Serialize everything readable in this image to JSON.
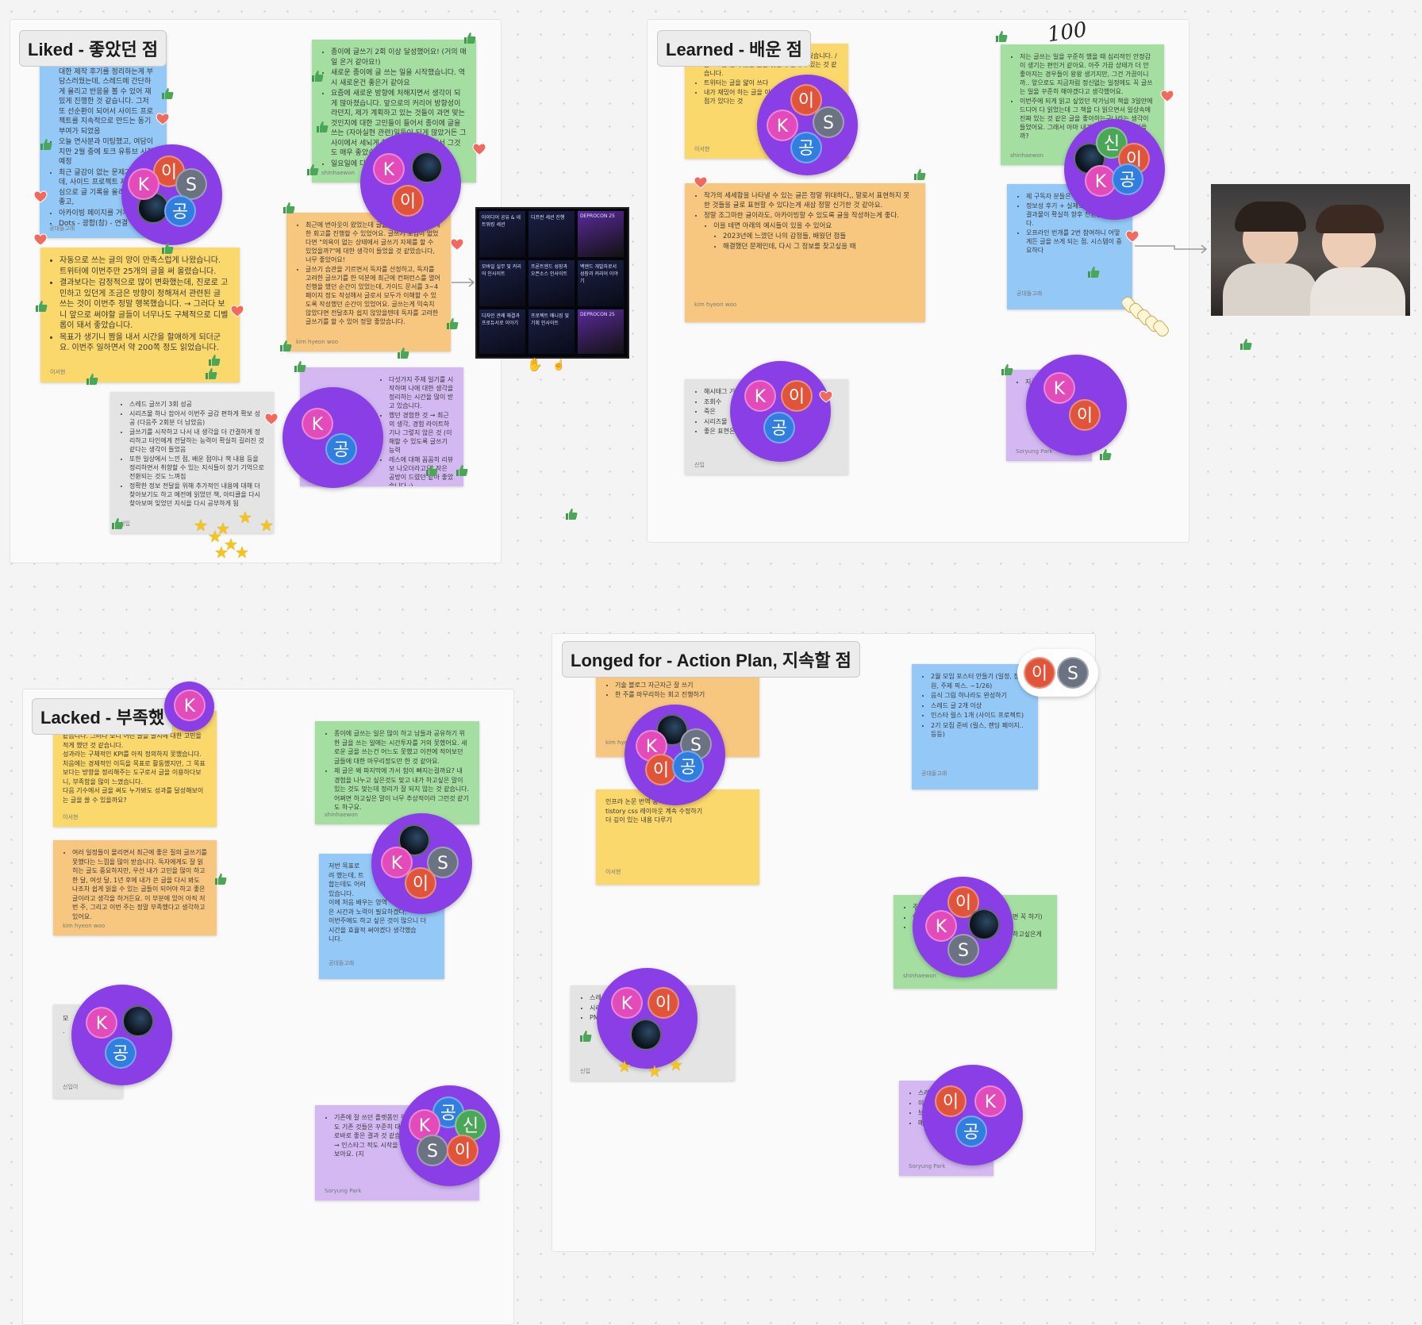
{
  "sections": {
    "liked": "Liked - 좋았던 점",
    "learned": "Learned - 배운 점",
    "lacked": "Lacked - 부족했",
    "longed": "Longed for -  Action Plan, 지속할 점"
  },
  "handwriting": "100",
  "avatars": {
    "k": "K",
    "i": "이",
    "s": "S",
    "g": "공",
    "sin": "신"
  },
  "colors": {
    "cluster": "#8a3ee6",
    "thumb": "#4aa757",
    "heart": "#f06a5e",
    "star": "#f5c518"
  },
  "stickies": {
    "liked_blue": {
      "items": [
        "사이드 프로젝트를 만들고 이에 대한 제작 후기를 정리하는게 부담스러웠는데, 스레드에 간단하게 올리고 반응을 볼 수 있어 재밌게 진행한 것 같습니다. 그저 또 선순환이 되어서 사이드 프로젝트를 지속적으로 만드는 동기부여가 되었음",
        "오늘 연사분과 미팅했고, 여담이지만 2월 중에 토크 유튜브 시작 예정",
        "최근 글감이 없는 문제가 있었는데, 사이드 프로젝트 제작기를 중심으로 글 기록을 올리니 반응도 좋고,",
        "아카이빙 페이지를 거쳐",
        "Dots - 광합(참) - 연결"
      ],
      "author": "공대돌고래"
    },
    "liked_green": {
      "items": [
        "종이에 글쓰기 2회 이상 달성했어요! (거의 매일 온거 같아요!)",
        "새로운 종이에 글 쓰는 일을 시작했습니다. 역시 새로운건 좋은거 같아요",
        "요즘에 새로운 방향에 처해지면서 생각이 되게 많아졌습니다. 앞으로의 커리어 방향성이라던지, 제가 계획하고 있는 것들이 과연 맞는것인지에 대한 고민들이 들어서 종이에 글을 쓰는 (자아실현 관련)일들이 되게 많았거든 그 사이에서 세뇌게 찾은 주제들이 있어서 그것도 매우 좋았습니다.",
        "일요일에 다음주"
      ],
      "author": "shinhaewon"
    },
    "liked_yellow": {
      "items": [
        "자동으로 쓰는 글의 양이 만족스럽게 나왔습니다. 트위터에 이번주만 25개의 글을 써 올렸습니다.",
        "결과보다는 감정적으로 많이 변화했는데, 진로로 고민하고 있던게 조금은 방향이 정해져서 관련된 글 쓰는 것이 이번주 정말 행복했습니다. → 그러다 보니 앞으로 써야할 글들이 너무나도 구체적으로 디벨롭이 돼서 좋았습니다.",
        "목표가 생기니 짬을 내서 시간을 할애하게 되더군요. 이번주 일하면서 약 200쪽 정도 읽었습니다."
      ],
      "author": "이서현"
    },
    "liked_orange": {
      "items": [
        "최근에 번아웃이 왔었는데 글을 쓰면서 번아웃에 대한 회고를 진행할 수 있었어요. 글쓰기 모임이 없었다면 \"의욕이 없는 상태에서 글쓰기 자체를 할 수 있었을까?\"에 대한 생각이 들었을 것 같았습니다, 너무 좋았어요!",
        "글쓰기 습관을 기르면서 독자를 선정하고, 독자를 고려한 글쓰기를 한 덕분에 최근에 컨퍼런스를 열어 진행을 했던 순간이 있었는데, 가이드 문서를 3~4 페이지 정도 작성해서 글로서 모두가 이해할 수 있도록 작성했던 순간이 있었어요. 글쓰는게 익숙치 않았다면 전달조차 쉽지 않았을텐데 독자를 고려한 글쓰기를 할 수 있어 정말 좋았습니다."
      ],
      "author": "kim hyeon woo"
    },
    "liked_gray": {
      "items": [
        "스레드 글쓰기 3회 성공",
        "시리즈물 하나 잡아서 이번주 글감 편하게 확보 성공 (다음주 2회분 더 남았음)",
        "글쓰기를 시작하고 나서 내 생각을 더 간결하게 정리하고 타인에게 전달하는 능력이 확실히 길러진 것 같다는 생각이 들었음",
        "또한 일상에서 느낀 점, 배운 점이나 책 내용 등을 정리하면서 취향할 수 있는 지식들이 장기 기억으로 전환되는 것도 느껴짐",
        "정확한 정보 전달을 위해 추가적인 내용에 대해 더 찾아보기도 하고 예전에 읽었던 책, 아티클을 다시 찾아보며 잊었던 지식을 다시 공부하게 됨"
      ],
      "author": "신입"
    },
    "liked_purple": {
      "items": [
        "다섯가지 주제 일기를 시작하며 나에 대한 생각을 정리하는 시간을 많이 받고 있습니다.",
        "했던 경험한 것 → 최근의 생각, 경험 라이트하기나 그렇지 않은 것 (이해할 수 있도록 글쓰기 능력",
        "레스에 대해 꼼꼼히 리뷰 보 나오더라고요. 작은 공방이 드렸던 같아 좋았습니다 :)"
      ],
      "author": ""
    },
    "learned_yellow": {
      "items": [
        "을 너무 간헌하게 확장시켜주는 것을 배웠습니다. / 볼로그는 깊이 있는 글을 찾는데 한계가 있는 것 같습니다.",
        "트위터는 글을 얇이 쓰다",
        "내가 재밌어 하는 글을 이게가 아니라 만드는 시작점가 있다는 것"
      ],
      "author": "이서현"
    },
    "learned_orange": {
      "items": [
        "작가의 세세함을 나타낼 수 있는 글은 정말 위대하다,, 말로서 표현하지 못한 것들을 글로 표현할 수 있다는게 새삼 정말 신기한 것 같아요.",
        "정말 조그마한 글이라도, 아카이빙할 수 있도록 글을 작성하는게 좋다.",
        "이을 테면 아래의 예시들이 있을 수 있어요",
        "2023년에 느꼈던 나의 감정들, 배웠던 점들",
        "해결했던 문제인데, 다시 그 정보를 찾고싶을 때"
      ],
      "author": "kim hyeon woo"
    },
    "learned_gray": {
      "items": [
        "해시태그 기",
        "조회수",
        "죽은",
        "시리즈물",
        "좋은 표현은"
      ],
      "author": "신입"
    },
    "learned_green": {
      "items": [
        "저는 글쓰는 일을 꾸준히 했을 때 심리적인 안정감이 생기는 편인거 같아요. 아주 가끔 상태가 더 안좋아지는 경우들이 왕왕 생기지만, 그건 가끔이니까.. 앞으로도 지금처럼 정신없는 일정에도 꼭 글쓰는 일을 꾸준히 해야겠다고 생각했어요.",
        "이번주에 되게 읽고 싶었던 작가님의 책을 3일만에 드디어 다 읽었는데 그 책을 다 읽으면서 일상속에 진짜 있는 것 같은 글을 좋아하는구나라는 생각이 들었어요. 그래서 아마 내가 쓰는 글도 이런 것을 까?"
      ],
      "author": "shinhaewon"
    },
    "learned_blue": {
      "items": [
        "제 구독자 분들은",
        "정보성 후기 + 실제로 이를 활용 한 결과물이 확실히 향후 전환율이 높다.",
        "오프라인 번개를 2번 참여하니 어떻게든 글을 쓰게 되는 점. 시스템이 중요하다"
      ],
      "author": "공대돌고래"
    },
    "learned_purple": {
      "items": [
        "지금"
      ],
      "author": "Soryung Park"
    },
    "lacked_yellow": {
      "lines": [
        "같습니다. 그러다 보니 어떤 글을 쓸지에 대한 고민을 적게 했던 것 같습니다.",
        "성과라는 구체적인 KPI를 아직 정의하지 못했습니다. 처음에는 경제적인 이득을 목표로 활동했지만, 그 목표보다는 방향을 정리해주는 도구로서 글을 이용하다보니, 부족함을 많이 느꼈습니다.",
        "다음 기수에서 글을 써도 누가봐도 성과를 달성해보이는 글을 쓸 수 있을까요?"
      ],
      "author": "이서현"
    },
    "lacked_orange": {
      "items": [
        "여러 일정들이 몰리면서 최근에 좋은 질의 글쓰기를 못했다는 느낌을 많이 받습니다. 독자에게도 잘 읽히는 글도 중요하지만, 우선 내가 고민을 많이 하고 한 달, 여섯 달, 1년 후에 내가 쓴 글을 다시 봐도 나조차 쉽게 읽을 수 있는 글들이 되어야 하고 좋은 글이라고 생각을 하거든요. 이 부분에 있어 아직 저번 주, 그리고 이번 주는 정말 부족했다고 생각하고 있어요."
      ],
      "author": "kim hyeon woo"
    },
    "lacked_green": {
      "items": [
        "종이에 글쓰는 일은 많이 하고 남들과 공유하기 위한 글을 쓰는 일에는 시간투자를 거의 못했어요. 새로운 글을 쓰는건 어느도 못했고 이전에 적어보던 글들에 대한 마무리정도만 한 것 같아요.",
        "제 글은 왜 파지막에 가서 힘이 빠지는걸까요? 내 경험을 나누고 싶은것도 맞고 내가 하고싶은 말이 있는 것도 맞는데 정리가 잘 되지 않는 것 같습니다. 어쩌면 하고싶은 말이 너무 추상적이라 그런것 같기도 하구요."
      ],
      "author": "shinhaewon"
    },
    "lacked_blue": {
      "lines": [
        "저번 목표로",
        "려 했는데, 트",
        "합는데도 어려",
        "있습니다.",
        "이에 처음 배우는 영역",
        "은 시간과 노력이 필요하겠다,",
        "이번주에도 하고 싶은 것이 많으니 더",
        "시간을 효율적 써야겠다 생각했습",
        "니다."
      ],
      "author": "공대돌고래"
    },
    "lacked_gray": {
      "lines": [
        "모",
        "."
      ],
      "author": "신입이"
    },
    "lacked_purple": {
      "items": [
        "기존에 잘 쓰던 플랫폼인 워 래도 기존 것들은 꾸준히 대해 바로바로 좋은 결과 것 같습니다. → 인스타그 적도 시작을 못해보아요. (지"
      ],
      "author": "Soryung Park"
    },
    "longed_orange": {
      "items": [
        "브랜치 연재하기",
        "기술 블로그 자근자근 잘 쓰기",
        "한 주를 마무리하는 회고 진행하기"
      ],
      "author": "kim hyeon"
    },
    "longed_yellow": {
      "lines": [
        "인프라 논문 번역 공",
        "tistory css 레이아웃 계속 수정하기",
        "더 깊이 있는 내용 다루기"
      ],
      "author": "이서현"
    },
    "longed_blue": {
      "items": [
        "2월 모임 포스터 만들기 (일정, 장인원, 주제 픽스. ~1/26)",
        "음식 그림 하나라도 완성하기",
        "스레드 글 2개 이상",
        "인스타 릴스 1개 (사이드 프로젝트)",
        "2기 모집 준비 (릴스, 랜딩 페이지.. 등등)"
      ],
      "author": "공대돌고래"
    },
    "longed_green": {
      "items": [
        "주",
        "일",
        "새로"
      ],
      "extra": [
        "면 꼭 하기)",
        "하고싶은게"
      ],
      "author": "shinhaewon"
    },
    "longed_gray": {
      "items": [
        "스레",
        "시리",
        "PM"
      ],
      "author": "신입"
    },
    "longed_purple": {
      "items": [
        "스레",
        "이",
        "브",
        "매"
      ],
      "author": "Soryung Park"
    }
  },
  "images": {
    "grid": [
      "아이디어 공유 & 네트워킹 세션",
      "디프런 세션 진행",
      "DEPROCON 25",
      "모바일 실무 및 커리어 인사이트",
      "프론트엔드 성장과 오픈소스 인사이트",
      "백엔드 개발자로서 성장과 커리어 이야기",
      "디자인 관례 해결과 프로듀서로 이야기",
      "프로젝트 매니징 및 기획 인사이트",
      "DEPROCON 25"
    ]
  }
}
